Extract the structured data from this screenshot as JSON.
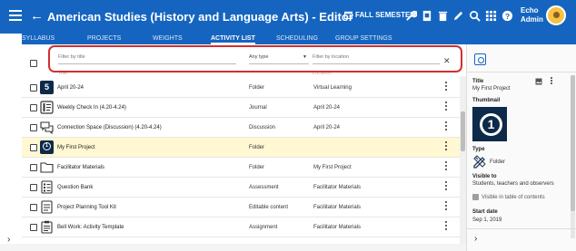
{
  "header": {
    "title": "American Studies (History and Language Arts) - Editor",
    "semester": "FALL SEMESTER",
    "user_first": "Echo",
    "user_last": "Admin"
  },
  "tabs": [
    "SYLLABUS",
    "PROJECTS",
    "WEIGHTS",
    "ACTIVITY LIST",
    "SCHEDULING",
    "GROUP SETTINGS"
  ],
  "active_tab": "ACTIVITY LIST",
  "filters": {
    "title_placeholder": "Filter by title",
    "type_value": "Any type",
    "location_placeholder": "Filter by location",
    "col_title": "Title",
    "col_location": "Location"
  },
  "rows": [
    {
      "title": "April 20-24",
      "type": "Folder",
      "location": "Virtual Learning",
      "icon": "number-5-icon"
    },
    {
      "title": "Weekly Check In (4.20-4.24)",
      "type": "Journal",
      "location": "April 20-24",
      "icon": "journal-icon"
    },
    {
      "title": "Connection Space (Discussion) (4.20-4.24)",
      "type": "Discussion",
      "location": "April 20-24",
      "icon": "discussion-icon"
    },
    {
      "title": "My First Project",
      "type": "Folder",
      "location": "",
      "icon": "project-number-1-icon",
      "selected": true
    },
    {
      "title": "Facilitator Materials",
      "type": "Folder",
      "location": "My First Project",
      "icon": "folder-icon"
    },
    {
      "title": "Question Bank",
      "type": "Assessment",
      "location": "Facilitator Materials",
      "icon": "assessment-icon"
    },
    {
      "title": "Project Planning Tool Kit",
      "type": "Editable content",
      "location": "Facilitator Materials",
      "icon": "page-icon"
    },
    {
      "title": "Bell Work: Activity Template",
      "type": "Assignment",
      "location": "Facilitator Materials",
      "icon": "assignment-icon"
    }
  ],
  "details": {
    "title_label": "Title",
    "title_value": "My First Project",
    "thumbnail_label": "Thumbnail",
    "type_label": "Type",
    "type_value": "Folder",
    "visible_label": "Visible to",
    "visible_value": "Students, teachers and observers",
    "visible_toc": "Visible in table of contents",
    "start_label": "Start date",
    "start_value": "Sep 1, 2019"
  },
  "colors": {
    "header": "#1565c0",
    "selected_row": "#fff8d2",
    "highlight_border": "#d32f2f",
    "thumbnail": "#0d2a4a"
  }
}
